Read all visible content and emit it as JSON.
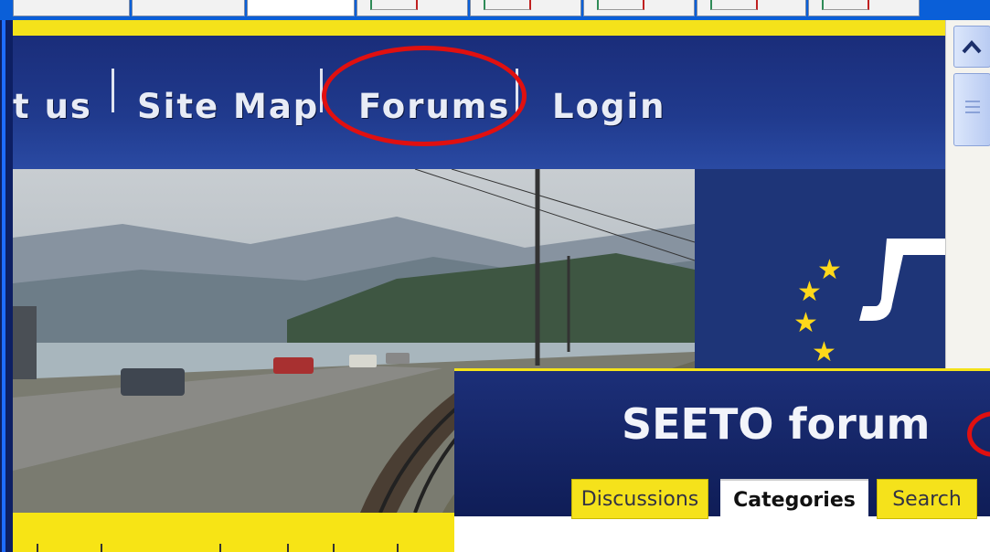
{
  "nav": {
    "items": [
      {
        "label": "t us"
      },
      {
        "label": "Site Map"
      },
      {
        "label": "Forums"
      },
      {
        "label": "Login"
      }
    ],
    "highlighted": "Forums"
  },
  "forum": {
    "title": "SEETO forum",
    "tabs": [
      {
        "label": "Discussions",
        "active": false
      },
      {
        "label": "Categories",
        "active": true
      },
      {
        "label": "Search",
        "active": false
      }
    ]
  },
  "colors": {
    "nav_background": "#203a8d",
    "accent_yellow": "#f4e21a",
    "highlight_red": "#e01010",
    "stars": "#ffd81a"
  },
  "icons": {
    "scroll_up": "chevron-up-icon",
    "scroll_thumb": "grip-icon",
    "stars": "star-icon"
  }
}
